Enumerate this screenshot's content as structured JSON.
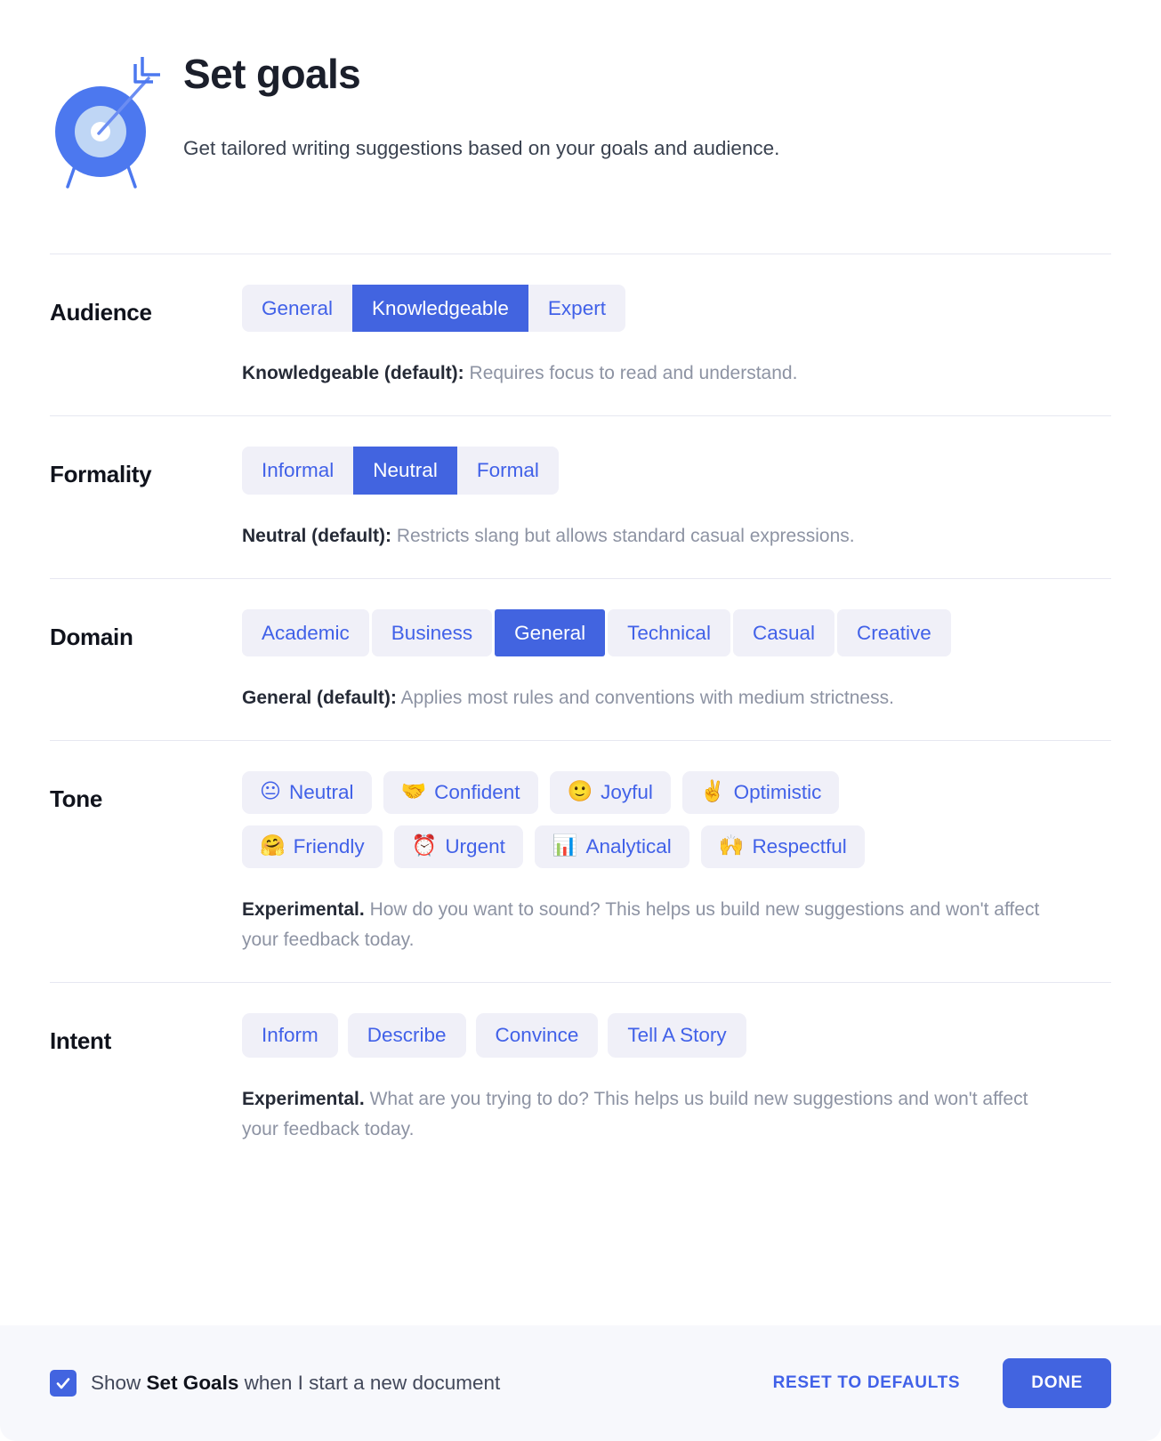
{
  "header": {
    "icon": "target-arrow-icon",
    "title": "Set goals",
    "subtitle": "Get tailored writing suggestions based on your goals and audience."
  },
  "sections": {
    "audience": {
      "label": "Audience",
      "options": [
        "General",
        "Knowledgeable",
        "Expert"
      ],
      "selected": "Knowledgeable",
      "helper_strong": "Knowledgeable (default):",
      "helper_rest": " Requires focus to read and understand."
    },
    "formality": {
      "label": "Formality",
      "options": [
        "Informal",
        "Neutral",
        "Formal"
      ],
      "selected": "Neutral",
      "helper_strong": "Neutral (default):",
      "helper_rest": " Restricts slang but allows standard casual expressions."
    },
    "domain": {
      "label": "Domain",
      "options": [
        "Academic",
        "Business",
        "General",
        "Technical",
        "Casual",
        "Creative"
      ],
      "selected": "General",
      "helper_strong": "General (default):",
      "helper_rest": " Applies most rules and conventions with medium strictness."
    },
    "tone": {
      "label": "Tone",
      "options": [
        {
          "emoji": "😐",
          "icon": "neutral-face-emoji",
          "label": "Neutral"
        },
        {
          "emoji": "🤝",
          "icon": "handshake-emoji",
          "label": "Confident"
        },
        {
          "emoji": "🙂",
          "icon": "slightly-smiling-face-emoji",
          "label": "Joyful"
        },
        {
          "emoji": "✌️",
          "icon": "victory-hand-emoji",
          "label": "Optimistic"
        },
        {
          "emoji": "🤗",
          "icon": "hugging-face-emoji",
          "label": "Friendly"
        },
        {
          "emoji": "⏰",
          "icon": "alarm-clock-emoji",
          "label": "Urgent"
        },
        {
          "emoji": "📊",
          "icon": "bar-chart-emoji",
          "label": "Analytical"
        },
        {
          "emoji": "🙌",
          "icon": "raising-hands-emoji",
          "label": "Respectful"
        }
      ],
      "selected": null,
      "helper_strong": "Experimental.",
      "helper_rest": " How do you want to sound? This helps us build new suggestions and won't affect your feedback today."
    },
    "intent": {
      "label": "Intent",
      "options": [
        "Inform",
        "Describe",
        "Convince",
        "Tell A Story"
      ],
      "selected": null,
      "helper_strong": "Experimental.",
      "helper_rest": " What are you trying to do? This helps us build new suggestions and won't affect your feedback today."
    }
  },
  "footer": {
    "checkbox_checked": true,
    "checkbox_label_pre": "Show ",
    "checkbox_label_strong": "Set Goals",
    "checkbox_label_post": " when I start a new document",
    "reset_label": "RESET TO DEFAULTS",
    "done_label": "DONE"
  },
  "colors": {
    "accent": "#4264e0",
    "accent_text": "#4161e8",
    "pill_bg": "#f0f0f8",
    "footer_bg": "#f7f8fc",
    "divider": "#e6e7f1",
    "title": "#10131c",
    "helper": "#8d93a3"
  }
}
